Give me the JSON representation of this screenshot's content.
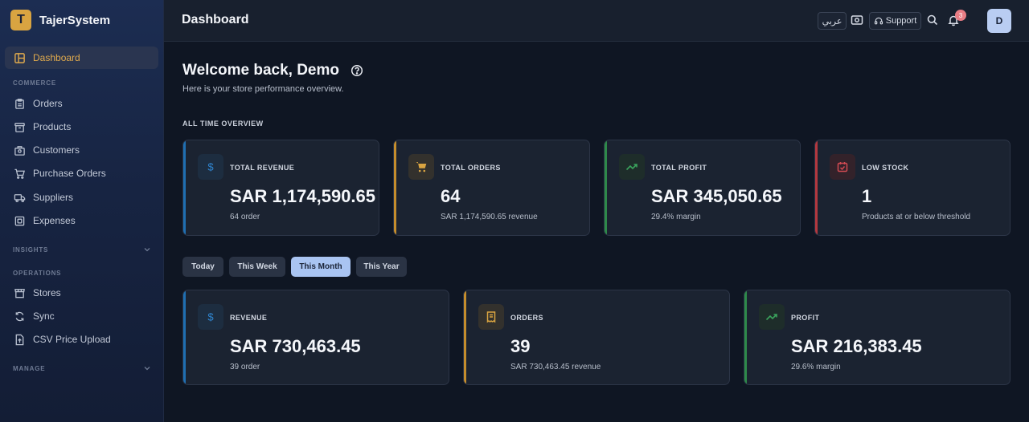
{
  "app": {
    "name": "TajerSystem",
    "logo_letter": "T"
  },
  "sidebar": {
    "dashboard": "Dashboard",
    "sections": {
      "commerce": "COMMERCE",
      "insights": "INSIGHTS",
      "operations": "OPERATIONS",
      "manage": "MANAGE"
    },
    "commerce_items": [
      "Orders",
      "Products",
      "Customers",
      "Purchase Orders",
      "Suppliers",
      "Expenses"
    ],
    "operations_items": [
      "Stores",
      "Sync",
      "CSV Price Upload"
    ]
  },
  "header": {
    "title": "Dashboard",
    "lang_button": "عربي",
    "support_button": "Support",
    "notification_count": "3",
    "avatar_initial": "D"
  },
  "main": {
    "welcome": "Welcome back, Demo",
    "subtitle": "Here is your store performance overview.",
    "overview_label": "ALL TIME OVERVIEW",
    "overview_cards": [
      {
        "label": "TOTAL REVENUE",
        "value": "SAR 1,174,590.65",
        "sub": "64 order"
      },
      {
        "label": "TOTAL ORDERS",
        "value": "64",
        "sub": "SAR 1,174,590.65 revenue"
      },
      {
        "label": "TOTAL PROFIT",
        "value": "SAR 345,050.65",
        "sub": "29.4% margin"
      },
      {
        "label": "LOW STOCK",
        "value": "1",
        "sub": "Products at or below threshold"
      }
    ],
    "period_tabs": [
      "Today",
      "This Week",
      "This Month",
      "This Year"
    ],
    "period_active": "This Month",
    "period_cards": [
      {
        "label": "REVENUE",
        "value": "SAR 730,463.45",
        "sub": "39 order"
      },
      {
        "label": "ORDERS",
        "value": "39",
        "sub": "SAR 730,463.45 revenue"
      },
      {
        "label": "PROFIT",
        "value": "SAR 216,383.45",
        "sub": "29.6% margin"
      }
    ]
  },
  "colors": {
    "revenue": "#1f6fb2",
    "orders": "#c58d2c",
    "profit": "#2e8a4a",
    "low_stock": "#b3383f",
    "active_nav": "#e0aa4d",
    "active_tab": "#a9c4f2"
  }
}
